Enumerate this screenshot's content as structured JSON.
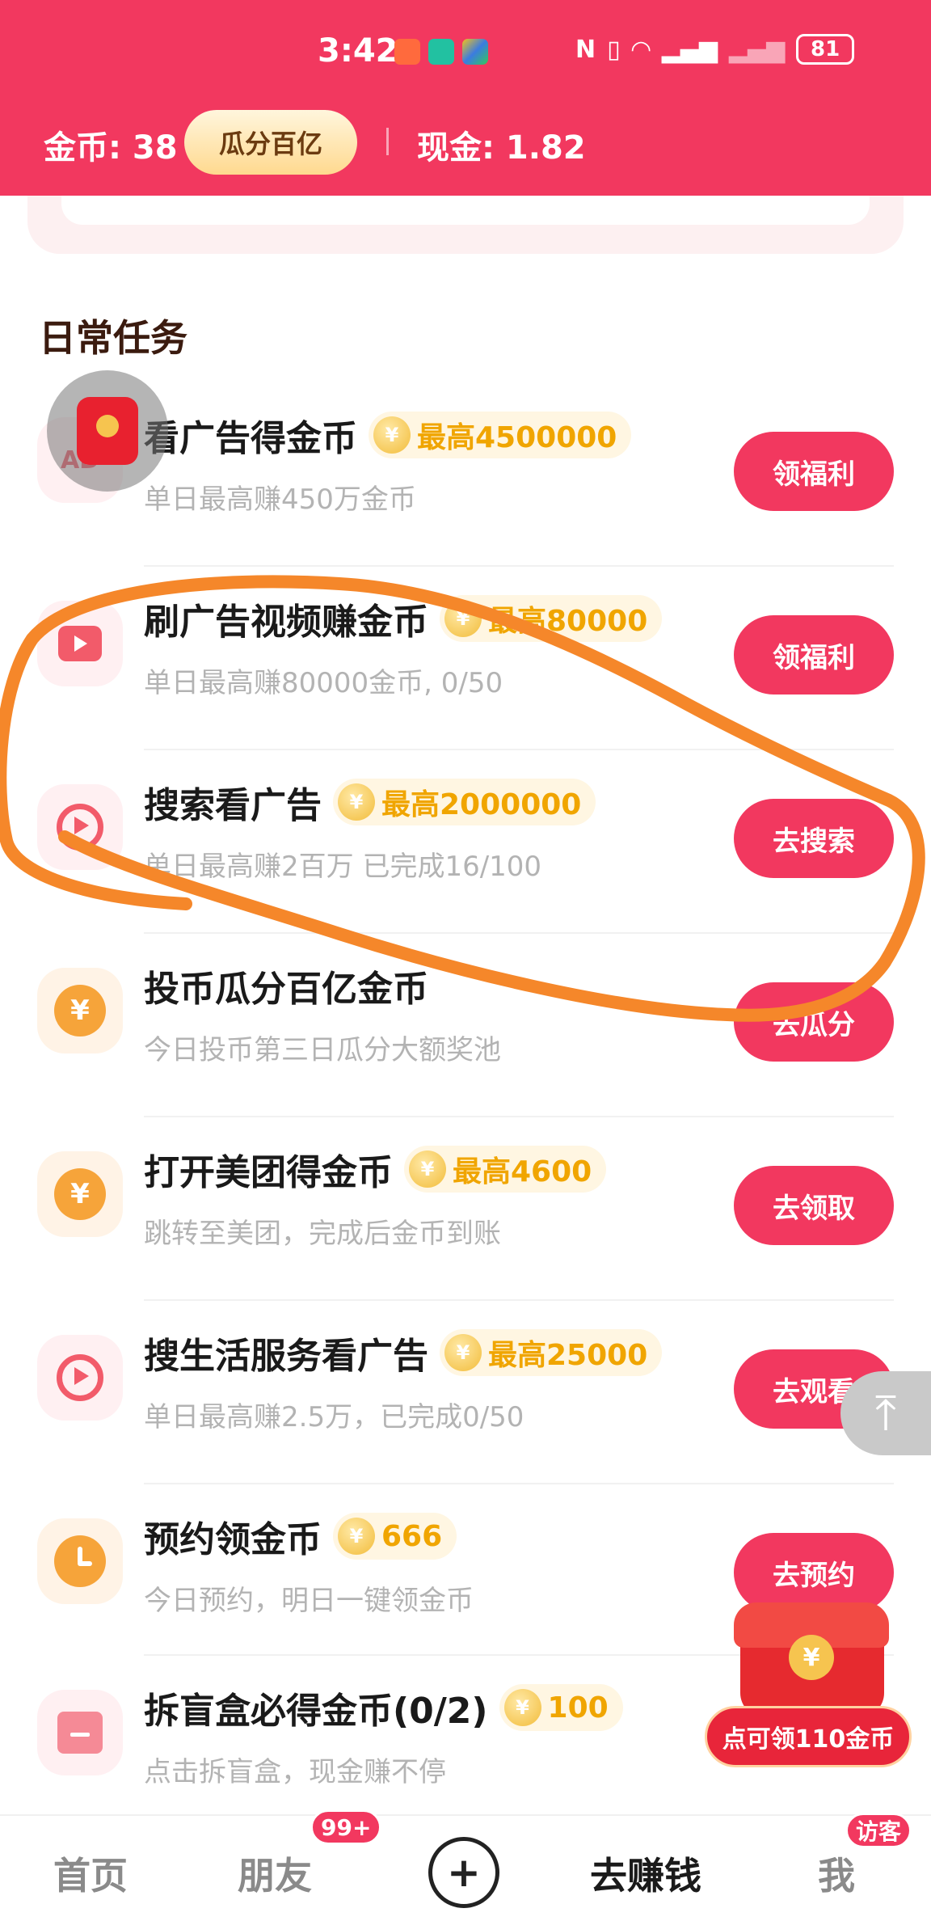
{
  "status_bar": {
    "time": "3:42",
    "battery": "81"
  },
  "header": {
    "coins_label": "金币: 38",
    "pill_label": "瓜分百亿",
    "cash_label": "现金: 1.82"
  },
  "section": {
    "title": "日常任务"
  },
  "tasks": [
    {
      "title": "看广告得金币",
      "reward": "最高4500000",
      "subtitle": "单日最高赚450万金币",
      "button": "领福利",
      "icon": "ad-icon"
    },
    {
      "title": "刷广告视频赚金币",
      "reward": "最高80000",
      "subtitle": "单日最高赚80000金币, 0/50",
      "button": "领福利",
      "icon": "video-icon"
    },
    {
      "title": "搜索看广告",
      "reward": "最高2000000",
      "subtitle": "单日最高赚2百万 已完成16/100",
      "button": "去搜索",
      "icon": "search-play-icon"
    },
    {
      "title": "投币瓜分百亿金币",
      "reward": "",
      "subtitle": "今日投币第三日瓜分大额奖池",
      "button": "去瓜分",
      "icon": "yen-coin-icon"
    },
    {
      "title": "打开美团得金币",
      "reward": "最高4600",
      "subtitle": "跳转至美团，完成后金币到账",
      "button": "去领取",
      "icon": "yen-coin-icon"
    },
    {
      "title": "搜生活服务看广告",
      "reward": "最高25000",
      "subtitle": "单日最高赚2.5万，已完成0/50",
      "button": "去观看",
      "icon": "search-play-icon"
    },
    {
      "title": "预约领金币",
      "reward": "666",
      "subtitle": "今日预约，明日一键领金币",
      "button": "去预约",
      "icon": "clock-icon"
    },
    {
      "title": "拆盲盒必得金币(0/2)",
      "reward": "100",
      "subtitle": "点击拆盲盒，现金赚不停",
      "button": "",
      "icon": "gift-icon"
    }
  ],
  "floating": {
    "treasure_label": "点可领110金币"
  },
  "bottom_nav": {
    "home": "首页",
    "friends": "朋友",
    "friends_badge": "99+",
    "earn": "去赚钱",
    "me": "我",
    "me_badge": "访客"
  },
  "colors": {
    "brand": "#f2385f",
    "reward_gold": "#f0a500",
    "annotation": "#f5872a"
  }
}
